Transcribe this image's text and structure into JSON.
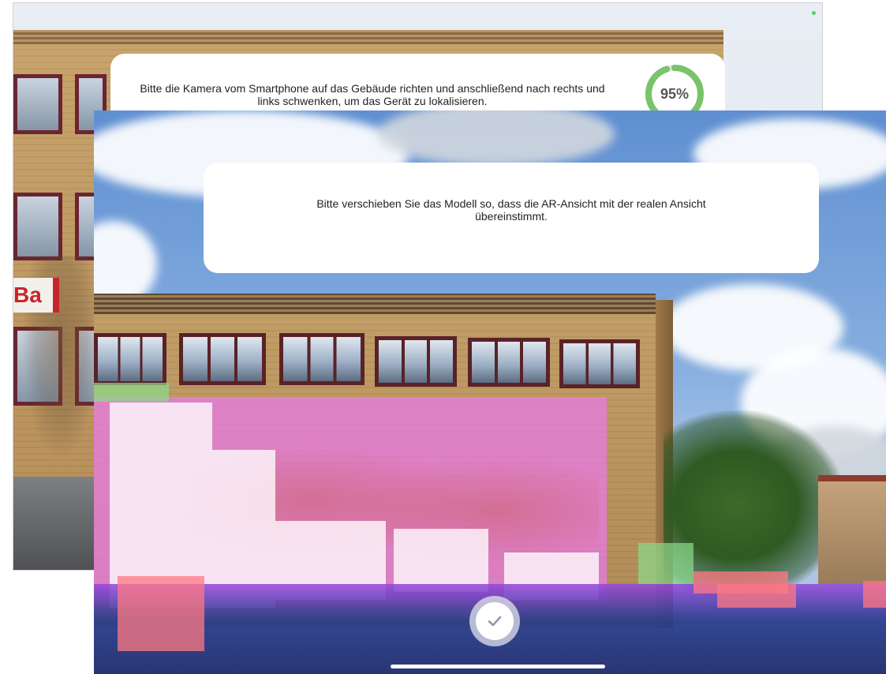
{
  "back_screen": {
    "instruction": "Bitte die Kamera vom Smartphone auf das Gebäude richten und anschließend nach rechts und links schwenken, um das Gerät zu lokalisieren.",
    "progress_label": "95%",
    "progress_fraction": 0.95,
    "progress_color": "#7ac36a",
    "sign_text": "Ba"
  },
  "front_screen": {
    "instruction": "Bitte verschieben Sie das Modell so, dass die AR-Ansicht mit der realen Ansicht übereinstimmt.",
    "confirm_icon": "checkmark-icon",
    "overlay_colors": {
      "magenta": "#ec78ec",
      "blue": "#283c8c",
      "pink": "#ff7882",
      "green": "#8cdc8c"
    }
  }
}
